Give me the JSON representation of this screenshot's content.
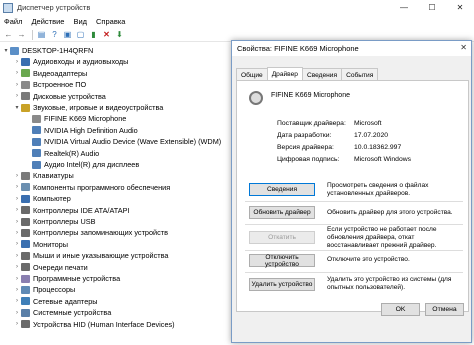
{
  "window": {
    "title": "Диспетчер устройств",
    "controls": [
      "—",
      "☐",
      "✕"
    ]
  },
  "menu": [
    "Файл",
    "Действие",
    "Вид",
    "Справка"
  ],
  "toolbar": [
    "back-icon",
    "forward-icon",
    "properties-icon",
    "help-icon",
    "update-driver-icon",
    "scan-icon",
    "disable-icon",
    "uninstall-icon",
    "download-icon"
  ],
  "tree": [
    {
      "label": "DESKTOP-1H4QRFN",
      "level": 0,
      "expander": "▾"
    },
    {
      "label": "Аудиовходы и аудиовыходы",
      "level": 1,
      "expander": "›"
    },
    {
      "label": "Видеоадаптеры",
      "level": 1,
      "expander": "›"
    },
    {
      "label": "Встроенное ПО",
      "level": 1,
      "expander": "›"
    },
    {
      "label": "Дисковые устройства",
      "level": 1,
      "expander": "›"
    },
    {
      "label": "Звуковые, игровые и видеоустройства",
      "level": 1,
      "expander": "▾"
    },
    {
      "label": "FIFINE K669 Microphone",
      "level": 2,
      "expander": ""
    },
    {
      "label": "NVIDIA High Definition Audio",
      "level": 2,
      "expander": ""
    },
    {
      "label": "NVIDIA Virtual Audio Device (Wave Extensible) (WDM)",
      "level": 2,
      "expander": ""
    },
    {
      "label": "Realtek(R) Audio",
      "level": 2,
      "expander": ""
    },
    {
      "label": "Аудио Intel(R) для дисплеев",
      "level": 2,
      "expander": ""
    },
    {
      "label": "Клавиатуры",
      "level": 1,
      "expander": "›"
    },
    {
      "label": "Компоненты программного обеспечения",
      "level": 1,
      "expander": "›"
    },
    {
      "label": "Компьютер",
      "level": 1,
      "expander": "›"
    },
    {
      "label": "Контроллеры IDE ATA/ATAPI",
      "level": 1,
      "expander": "›"
    },
    {
      "label": "Контроллеры USB",
      "level": 1,
      "expander": "›"
    },
    {
      "label": "Контроллеры запоминающих устройств",
      "level": 1,
      "expander": "›"
    },
    {
      "label": "Мониторы",
      "level": 1,
      "expander": "›"
    },
    {
      "label": "Мыши и иные указывающие устройства",
      "level": 1,
      "expander": "›"
    },
    {
      "label": "Очереди печати",
      "level": 1,
      "expander": "›"
    },
    {
      "label": "Программные устройства",
      "level": 1,
      "expander": "›"
    },
    {
      "label": "Процессоры",
      "level": 1,
      "expander": "›"
    },
    {
      "label": "Сетевые адаптеры",
      "level": 1,
      "expander": "›"
    },
    {
      "label": "Системные устройства",
      "level": 1,
      "expander": "›"
    },
    {
      "label": "Устройства HID (Human Interface Devices)",
      "level": 1,
      "expander": "›"
    }
  ],
  "dialog": {
    "title": "Свойства: FIFINE K669 Microphone",
    "close": "✕",
    "tabs": [
      "Общие",
      "Драйвер",
      "Сведения",
      "События"
    ],
    "active_tab": "Драйвер",
    "device_name": "FIFINE K669 Microphone",
    "props": [
      {
        "label": "Поставщик драйвера:",
        "value": "Microsoft"
      },
      {
        "label": "Дата разработки:",
        "value": "17.07.2020"
      },
      {
        "label": "Версия драйвера:",
        "value": "10.0.18362.997"
      },
      {
        "label": "Цифровая подпись:",
        "value": "Microsoft Windows"
      }
    ],
    "actions": [
      {
        "button": "Сведения",
        "desc": "Просмотреть сведения о файлах установленных драйверов.",
        "state": "primary"
      },
      {
        "button": "Обновить драйвер",
        "desc": "Обновить драйвер для этого устройства.",
        "state": "normal"
      },
      {
        "button": "Откатить",
        "desc": "Если устройство не работает после обновления драйвера, откат восстанавливает прежний драйвер.",
        "state": "disabled"
      },
      {
        "button": "Отключить устройство",
        "desc": "Отключите это устройство.",
        "state": "normal"
      },
      {
        "button": "Удалить устройство",
        "desc": "Удалить это устройство из системы (для опытных пользователей).",
        "state": "normal"
      }
    ],
    "ok": "OK",
    "cancel": "Отмена"
  }
}
